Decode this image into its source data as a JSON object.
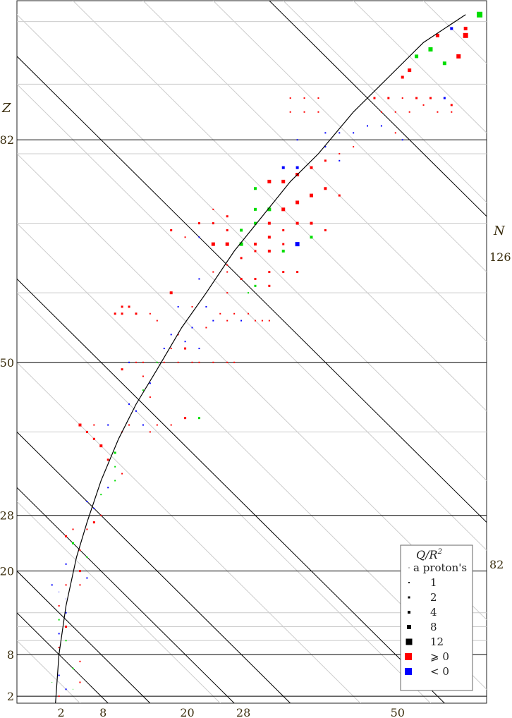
{
  "chart_data": {
    "type": "scatter",
    "title": "",
    "xlabel": "",
    "ylabel": "Z",
    "diag_label": "N",
    "xlim": [
      0,
      67
    ],
    "ylim": [
      1,
      102
    ],
    "x_ticks": [
      2,
      8,
      20,
      28,
      50
    ],
    "y_ticks": [
      2,
      8,
      20,
      28,
      50,
      82
    ],
    "diag_ticks": [
      82,
      126
    ],
    "magic_n_lines": [
      2,
      8,
      20,
      28,
      50,
      82,
      126
    ],
    "colors": {
      "positive": "#ff0000",
      "negative": "#0000ff",
      "prolate_alt": "#00dd00",
      "grid": "#cccccc",
      "line": "#000000"
    },
    "legend": {
      "title": "Q/R",
      "title_sup": "2",
      "entries": [
        {
          "label": "a proton's",
          "size": 1
        },
        {
          "label": "1",
          "size": 2
        },
        {
          "label": "2",
          "size": 3
        },
        {
          "label": "4",
          "size": 4
        },
        {
          "label": "8",
          "size": 6
        },
        {
          "label": "12",
          "size": 9
        },
        {
          "label": "⩾ 0",
          "color": "#ff0000"
        },
        {
          "label": "< 0",
          "color": "#0000ff"
        }
      ]
    },
    "stability_line": [
      [
        5.5,
        1
      ],
      [
        6,
        8
      ],
      [
        7,
        15
      ],
      [
        8.5,
        22
      ],
      [
        10,
        27
      ],
      [
        12,
        33
      ],
      [
        14.5,
        39
      ],
      [
        17,
        44
      ],
      [
        20,
        49
      ],
      [
        23.5,
        55
      ],
      [
        27,
        60
      ],
      [
        31,
        66
      ],
      [
        35,
        71
      ],
      [
        39,
        76
      ],
      [
        43,
        80
      ],
      [
        48,
        86
      ],
      [
        53,
        91
      ],
      [
        58,
        96
      ],
      [
        64,
        100
      ]
    ],
    "points": [
      [
        6,
        2,
        "r",
        2
      ],
      [
        7,
        3,
        "b",
        2
      ],
      [
        8,
        3,
        "g",
        1
      ],
      [
        9,
        4,
        "r",
        2
      ],
      [
        5,
        4,
        "g",
        1
      ],
      [
        6,
        5,
        "b",
        2
      ],
      [
        8,
        6,
        "g",
        2
      ],
      [
        9,
        7,
        "r",
        2
      ],
      [
        6,
        9,
        "r",
        2
      ],
      [
        7,
        10,
        "g",
        2
      ],
      [
        6,
        11,
        "b",
        2
      ],
      [
        7,
        12,
        "r",
        3
      ],
      [
        6,
        13,
        "g",
        2
      ],
      [
        7,
        14,
        "b",
        2
      ],
      [
        6,
        15,
        "r",
        2
      ],
      [
        7,
        16,
        "b",
        1
      ],
      [
        6,
        17,
        "b",
        1
      ],
      [
        5,
        18,
        "b",
        2
      ],
      [
        7,
        18,
        "r",
        2
      ],
      [
        9,
        18,
        "r",
        2
      ],
      [
        10,
        19,
        "b",
        2
      ],
      [
        9,
        20,
        "r",
        3
      ],
      [
        7,
        21,
        "b",
        2
      ],
      [
        10,
        22,
        "g",
        2
      ],
      [
        9,
        23,
        "r",
        2
      ],
      [
        8,
        24,
        "g",
        3
      ],
      [
        7,
        25,
        "r",
        3
      ],
      [
        8,
        26,
        "r",
        2
      ],
      [
        10,
        26,
        "r",
        2
      ],
      [
        11,
        27,
        "r",
        3
      ],
      [
        12,
        28,
        "r",
        2
      ],
      [
        11,
        29,
        "b",
        2
      ],
      [
        10,
        30,
        "b",
        2
      ],
      [
        12,
        31,
        "g",
        2
      ],
      [
        13,
        32,
        "b",
        2
      ],
      [
        14,
        33,
        "g",
        2
      ],
      [
        15,
        34,
        "r",
        2
      ],
      [
        14,
        35,
        "g",
        2
      ],
      [
        13,
        36,
        "r",
        3
      ],
      [
        14,
        37,
        "g",
        3
      ],
      [
        12,
        38,
        "r",
        4
      ],
      [
        11,
        39,
        "r",
        3
      ],
      [
        10,
        40,
        "r",
        3
      ],
      [
        9,
        41,
        "r",
        4
      ],
      [
        11,
        41,
        "r",
        2
      ],
      [
        13,
        41,
        "b",
        2
      ],
      [
        15,
        40,
        "r",
        2
      ],
      [
        16,
        41,
        "r",
        2
      ],
      [
        18,
        41,
        "b",
        2
      ],
      [
        19,
        40,
        "r",
        2
      ],
      [
        20,
        41,
        "r",
        2
      ],
      [
        22,
        41,
        "r",
        2
      ],
      [
        24,
        42,
        "r",
        3
      ],
      [
        26,
        42,
        "g",
        3
      ],
      [
        17,
        43,
        "b",
        2
      ],
      [
        16,
        44,
        "b",
        2
      ],
      [
        19,
        45,
        "r",
        2
      ],
      [
        18,
        46,
        "g",
        2
      ],
      [
        19,
        47,
        "b",
        2
      ],
      [
        18,
        48,
        "r",
        2
      ],
      [
        15,
        49,
        "r",
        3
      ],
      [
        16,
        50,
        "b",
        2
      ],
      [
        17,
        50,
        "r",
        2
      ],
      [
        18,
        50,
        "r",
        2
      ],
      [
        20,
        50,
        "g",
        2
      ],
      [
        21,
        50,
        "r",
        2
      ],
      [
        23,
        50,
        "r",
        2
      ],
      [
        25,
        50,
        "r",
        2
      ],
      [
        26,
        50,
        "r",
        2
      ],
      [
        28,
        50,
        "r",
        2
      ],
      [
        30,
        50,
        "r",
        2
      ],
      [
        31,
        50,
        "r",
        2
      ],
      [
        21,
        52,
        "b",
        2
      ],
      [
        22,
        52,
        "r",
        2
      ],
      [
        24,
        52,
        "r",
        3
      ],
      [
        26,
        52,
        "b",
        2
      ],
      [
        24,
        53,
        "b",
        2
      ],
      [
        22,
        54,
        "b",
        2
      ],
      [
        23,
        54,
        "r",
        2
      ],
      [
        25,
        55,
        "b",
        2
      ],
      [
        27,
        55,
        "r",
        2
      ],
      [
        28,
        56,
        "b",
        2
      ],
      [
        30,
        56,
        "r",
        2
      ],
      [
        32,
        56,
        "b",
        2
      ],
      [
        34,
        56,
        "r",
        2
      ],
      [
        36,
        56,
        "r",
        2
      ],
      [
        20,
        56,
        "r",
        2
      ],
      [
        19,
        57,
        "r",
        2
      ],
      [
        17,
        57,
        "r",
        3
      ],
      [
        16,
        58,
        "r",
        3
      ],
      [
        15,
        57,
        "r",
        3
      ],
      [
        14,
        57,
        "r",
        3
      ],
      [
        15,
        58,
        "r",
        3
      ],
      [
        23,
        58,
        "b",
        2
      ],
      [
        25,
        58,
        "r",
        2
      ],
      [
        27,
        58,
        "b",
        2
      ],
      [
        29,
        57,
        "r",
        2
      ],
      [
        31,
        57,
        "r",
        2
      ],
      [
        33,
        57,
        "r",
        2
      ],
      [
        35,
        56,
        "r",
        2
      ],
      [
        22,
        60,
        "r",
        4
      ],
      [
        26,
        62,
        "b",
        2
      ],
      [
        28,
        63,
        "r",
        2
      ],
      [
        30,
        63,
        "r",
        2
      ],
      [
        32,
        62,
        "r",
        3
      ],
      [
        34,
        62,
        "r",
        3
      ],
      [
        36,
        63,
        "r",
        3
      ],
      [
        30,
        60,
        "r",
        2
      ],
      [
        33,
        60,
        "g",
        2
      ],
      [
        34,
        61,
        "g",
        3
      ],
      [
        36,
        61,
        "r",
        3
      ],
      [
        38,
        63,
        "r",
        3
      ],
      [
        40,
        63,
        "r",
        3
      ],
      [
        30,
        64,
        "r",
        2
      ],
      [
        32,
        65,
        "r",
        3
      ],
      [
        34,
        66,
        "r",
        3
      ],
      [
        36,
        66,
        "r",
        4
      ],
      [
        38,
        66,
        "g",
        4
      ],
      [
        40,
        67,
        "b",
        6
      ],
      [
        42,
        68,
        "g",
        4
      ],
      [
        28,
        67,
        "r",
        5
      ],
      [
        30,
        67,
        "r",
        5
      ],
      [
        32,
        67,
        "g",
        5
      ],
      [
        34,
        67,
        "r",
        4
      ],
      [
        36,
        68,
        "r",
        4
      ],
      [
        38,
        67,
        "r",
        3
      ],
      [
        30,
        69,
        "r",
        3
      ],
      [
        32,
        69,
        "g",
        4
      ],
      [
        34,
        70,
        "g",
        4
      ],
      [
        36,
        70,
        "r",
        4
      ],
      [
        38,
        69,
        "r",
        3
      ],
      [
        40,
        70,
        "r",
        4
      ],
      [
        42,
        70,
        "r",
        4
      ],
      [
        44,
        69,
        "r",
        3
      ],
      [
        34,
        72,
        "g",
        4
      ],
      [
        36,
        72,
        "g",
        5
      ],
      [
        38,
        72,
        "r",
        5
      ],
      [
        40,
        73,
        "r",
        5
      ],
      [
        42,
        74,
        "r",
        5
      ],
      [
        44,
        75,
        "r",
        4
      ],
      [
        46,
        74,
        "r",
        3
      ],
      [
        26,
        68,
        "b",
        2
      ],
      [
        24,
        68,
        "r",
        2
      ],
      [
        22,
        69,
        "r",
        3
      ],
      [
        26,
        70,
        "r",
        3
      ],
      [
        28,
        70,
        "r",
        3
      ],
      [
        30,
        71,
        "r",
        3
      ],
      [
        28,
        72,
        "r",
        2
      ],
      [
        34,
        75,
        "g",
        4
      ],
      [
        36,
        76,
        "r",
        5
      ],
      [
        38,
        76,
        "r",
        5
      ],
      [
        40,
        77,
        "r",
        5
      ],
      [
        42,
        78,
        "r",
        4
      ],
      [
        44,
        79,
        "r",
        3
      ],
      [
        46,
        79,
        "b",
        2
      ],
      [
        38,
        78,
        "b",
        4
      ],
      [
        40,
        78,
        "b",
        4
      ],
      [
        42,
        78,
        "r",
        3
      ],
      [
        46,
        80,
        "r",
        2
      ],
      [
        48,
        81,
        "r",
        2
      ],
      [
        44,
        81,
        "b",
        2
      ],
      [
        40,
        82,
        "b",
        2
      ],
      [
        44,
        83,
        "b",
        2
      ],
      [
        46,
        83,
        "b",
        2
      ],
      [
        48,
        83,
        "b",
        2
      ],
      [
        50,
        84,
        "b",
        2
      ],
      [
        52,
        84,
        "b",
        2
      ],
      [
        54,
        83,
        "r",
        2
      ],
      [
        55,
        82,
        "b",
        2
      ],
      [
        39,
        86,
        "r",
        2
      ],
      [
        41,
        86,
        "r",
        2
      ],
      [
        43,
        86,
        "r",
        2
      ],
      [
        39,
        88,
        "r",
        2
      ],
      [
        41,
        88,
        "r",
        2
      ],
      [
        43,
        88,
        "r",
        2
      ],
      [
        51,
        88,
        "r",
        3
      ],
      [
        53,
        88,
        "r",
        3
      ],
      [
        55,
        88,
        "r",
        2
      ],
      [
        57,
        88,
        "r",
        3
      ],
      [
        59,
        88,
        "r",
        3
      ],
      [
        61,
        88,
        "b",
        3
      ],
      [
        62,
        87,
        "r",
        3
      ],
      [
        52,
        86,
        "r",
        2
      ],
      [
        54,
        86,
        "r",
        2
      ],
      [
        56,
        86,
        "r",
        2
      ],
      [
        58,
        87,
        "r",
        2
      ],
      [
        60,
        86,
        "r",
        2
      ],
      [
        62,
        86,
        "r",
        2
      ],
      [
        55,
        91,
        "r",
        4
      ],
      [
        56,
        92,
        "r",
        5
      ],
      [
        57,
        94,
        "g",
        5
      ],
      [
        59,
        95,
        "g",
        6
      ],
      [
        61,
        93,
        "g",
        5
      ],
      [
        63,
        94,
        "r",
        6
      ],
      [
        64,
        97,
        "r",
        7
      ],
      [
        60,
        97,
        "r",
        5
      ],
      [
        62,
        98,
        "b",
        4
      ],
      [
        64,
        98,
        "r",
        5
      ],
      [
        66,
        100,
        "g",
        8
      ]
    ]
  }
}
